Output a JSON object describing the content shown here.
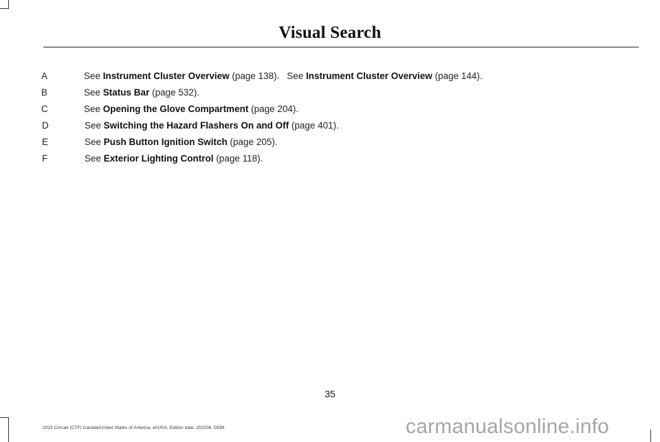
{
  "header": {
    "title": "Visual Search"
  },
  "legend": [
    {
      "key": "A",
      "refs": [
        {
          "see": "See",
          "link": "Instrument Cluster Overview",
          "page": "(page 138)."
        },
        {
          "see": "See",
          "link": "Instrument Cluster Overview",
          "page": "(page 144)."
        }
      ]
    },
    {
      "key": "B",
      "refs": [
        {
          "see": "See",
          "link": "Status Bar",
          "page": "(page 532)."
        }
      ]
    },
    {
      "key": "C",
      "refs": [
        {
          "see": "See",
          "link": "Opening the Glove Compartment",
          "page": "(page 204)."
        }
      ]
    },
    {
      "key": "D",
      "refs": [
        {
          "see": "See",
          "link": "Switching the Hazard Flashers On and Off",
          "page": "(page 401)."
        }
      ]
    },
    {
      "key": "E",
      "refs": [
        {
          "see": "See",
          "link": "Push Button Ignition Switch",
          "page": "(page 205)."
        }
      ]
    },
    {
      "key": "F",
      "refs": [
        {
          "see": "See",
          "link": "Exterior Lighting Control",
          "page": "(page 118)."
        }
      ]
    }
  ],
  "footer": {
    "page_number": "35",
    "edition_text": "2023 Corsair (CTF) Canada/United States of America, enUSA, Edition date: 202208, DOM",
    "watermark": "carmanualsonline.info"
  }
}
